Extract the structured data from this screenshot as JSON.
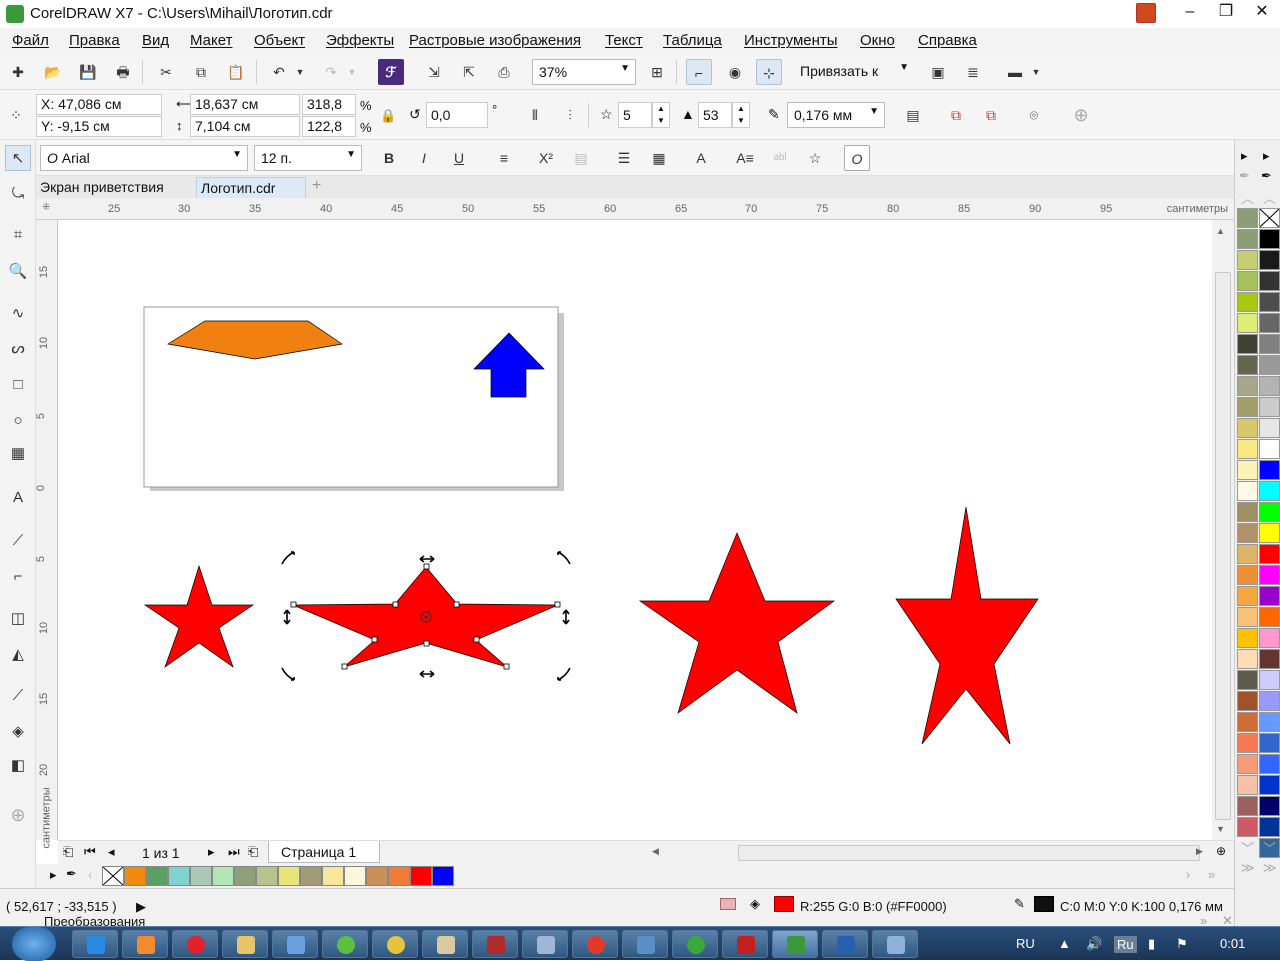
{
  "window": {
    "title": "CorelDRAW X7 - C:\\Users\\Mihail\\Логотип.cdr"
  },
  "menu": [
    "Файл",
    "Правка",
    "Вид",
    "Макет",
    "Объект",
    "Эффекты",
    "Растровые изображения",
    "Текст",
    "Таблица",
    "Инструменты",
    "Окно",
    "Справка"
  ],
  "toolbar": {
    "zoom": "37%",
    "snap_label": "Привязать к"
  },
  "properties": {
    "x": "X: 47,086 см",
    "y": "Y: -9,15 см",
    "width": "18,637 см",
    "height": "7,104 см",
    "scale_w": "318,8",
    "scale_h": "122,8",
    "percent": "%",
    "rotation": "0,0",
    "degree": "°",
    "points": "5",
    "sharpness": "53",
    "outline": "0,176 мм"
  },
  "textbar": {
    "font": "Arial",
    "size": "12 п."
  },
  "tabs": [
    "Экран приветствия",
    "Логотип.cdr"
  ],
  "ruler": {
    "h_ticks": [
      "25",
      "30",
      "35",
      "40",
      "45",
      "50",
      "55",
      "60",
      "65",
      "70",
      "75",
      "80",
      "85",
      "90",
      "95"
    ],
    "v_ticks": [
      "15",
      "10",
      "5",
      "0",
      "5",
      "10",
      "15",
      "20"
    ],
    "unit": "сантиметры"
  },
  "pagenav": {
    "count": "1 из 1",
    "page_tab": "Страница 1"
  },
  "status": {
    "coords": "( 52,617 ; -33,515 )",
    "panel_title": "Преобразования",
    "fill": "R:255 G:0 B:0 (#FF0000)",
    "outline": "C:0 M:0 Y:0 K:100  0,176 мм"
  },
  "colors": {
    "accent": "#2e6bb0",
    "star": "#ff0000",
    "hexagon": "#f08010",
    "arrow": "#0000ff",
    "doc_palette": [
      "#f28a10",
      "#5aa064",
      "#7fd3cf",
      "#a9c9b6",
      "#b2e6b4",
      "#8ea07a",
      "#b7c38d",
      "#e6e47a",
      "#a09b76",
      "#f7e79a",
      "#fdf6da",
      "#cb8f5b",
      "#f07c38",
      "#ff0000",
      "#0000ff"
    ],
    "palette_left": [
      "#8f9c78",
      "#8f9c78",
      "#c6cc74",
      "#a7c15a",
      "#a8c816",
      "#dced76",
      "#3f4232",
      "#62674d",
      "#a6a68a",
      "#9e9e6b",
      "#d7c66a",
      "#fbe784",
      "#fdf2b6",
      "#fdf9e4",
      "#9d9066",
      "#b19169",
      "#ddb56a",
      "#ef8f38",
      "#f7a740",
      "#f9c27a",
      "#ffc200",
      "#ffdcb3",
      "#5f5b4c",
      "#a0532b",
      "#cd6d36",
      "#f57a52",
      "#f69b7a",
      "#f6c0a9",
      "#9b6161",
      "#cc5a66"
    ],
    "palette_right": [
      "#000000",
      "#1a1a1a",
      "#333333",
      "#4d4d4d",
      "#666666",
      "#808080",
      "#999999",
      "#b3b3b3",
      "#cccccc",
      "#e6e6e6",
      "#ffffff",
      "#0000ff",
      "#00ffff",
      "#00ff00",
      "#ffff00",
      "#ff0000",
      "#ff00ff",
      "#9900cc",
      "#ff6600",
      "#ff99cc",
      "#663333",
      "#ccccff",
      "#9999ff",
      "#6699ff",
      "#3366cc",
      "#3366ff",
      "#0033cc",
      "#000066",
      "#003399",
      "#336699"
    ]
  },
  "tray": {
    "lang": "RU",
    "ime": "Ru",
    "time": "0:01"
  }
}
